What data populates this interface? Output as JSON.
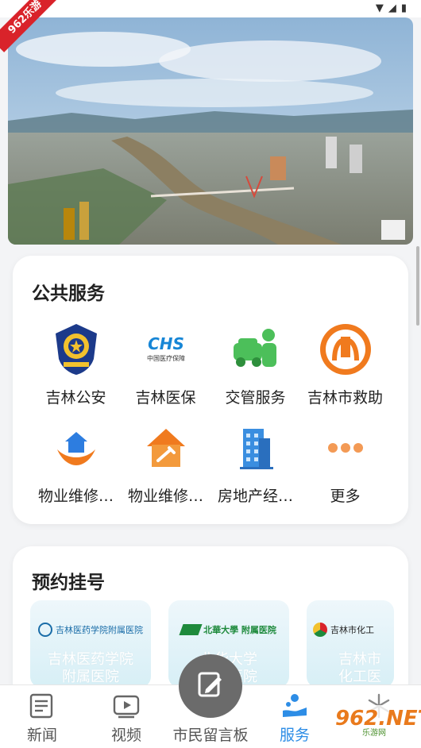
{
  "status_bar": {
    "icons": [
      "wifi-icon",
      "signal-icon",
      "battery-icon"
    ]
  },
  "badge": {
    "text": "962乐游"
  },
  "public_services": {
    "title": "公共服务",
    "items": [
      {
        "label": "吉林公安",
        "icon": "police-badge-icon"
      },
      {
        "label": "吉林医保",
        "icon": "chs-medical-insurance-icon"
      },
      {
        "label": "交管服务",
        "icon": "traffic-management-icon"
      },
      {
        "label": "吉林市救助",
        "icon": "relief-icon"
      },
      {
        "label": "物业维修…",
        "icon": "house-hands-icon"
      },
      {
        "label": "物业维修…",
        "icon": "house-wrench-icon"
      },
      {
        "label": "房地产经…",
        "icon": "building-icon"
      },
      {
        "label": "更多",
        "icon": "more-dots-icon"
      }
    ]
  },
  "appointment": {
    "title": "预约挂号",
    "hospitals": [
      {
        "name_line1": "吉林医药学院",
        "name_line2": "附属医院",
        "logo_text": "吉林医药学院附属医院"
      },
      {
        "name_line1": "北华大学",
        "name_line2": "附属医院",
        "logo_text": "北華大學 附属医院"
      },
      {
        "name_line1": "吉林市",
        "name_line2": "化工医院",
        "logo_text": "吉林市化工"
      }
    ]
  },
  "tabbar": {
    "tabs": [
      {
        "label": "新闻",
        "icon": "news-icon"
      },
      {
        "label": "视频",
        "icon": "video-icon"
      },
      {
        "label": "市民留言板",
        "icon": "message-board-icon"
      },
      {
        "label": "服务",
        "icon": "service-icon",
        "active": true
      },
      {
        "label": "",
        "icon": "snowflake-icon"
      }
    ]
  },
  "watermark": {
    "text": "962.NET",
    "sub": "乐游网"
  },
  "colors": {
    "accent": "#2d8de6",
    "badge": "#d9232a",
    "orange": "#f07a1e"
  }
}
